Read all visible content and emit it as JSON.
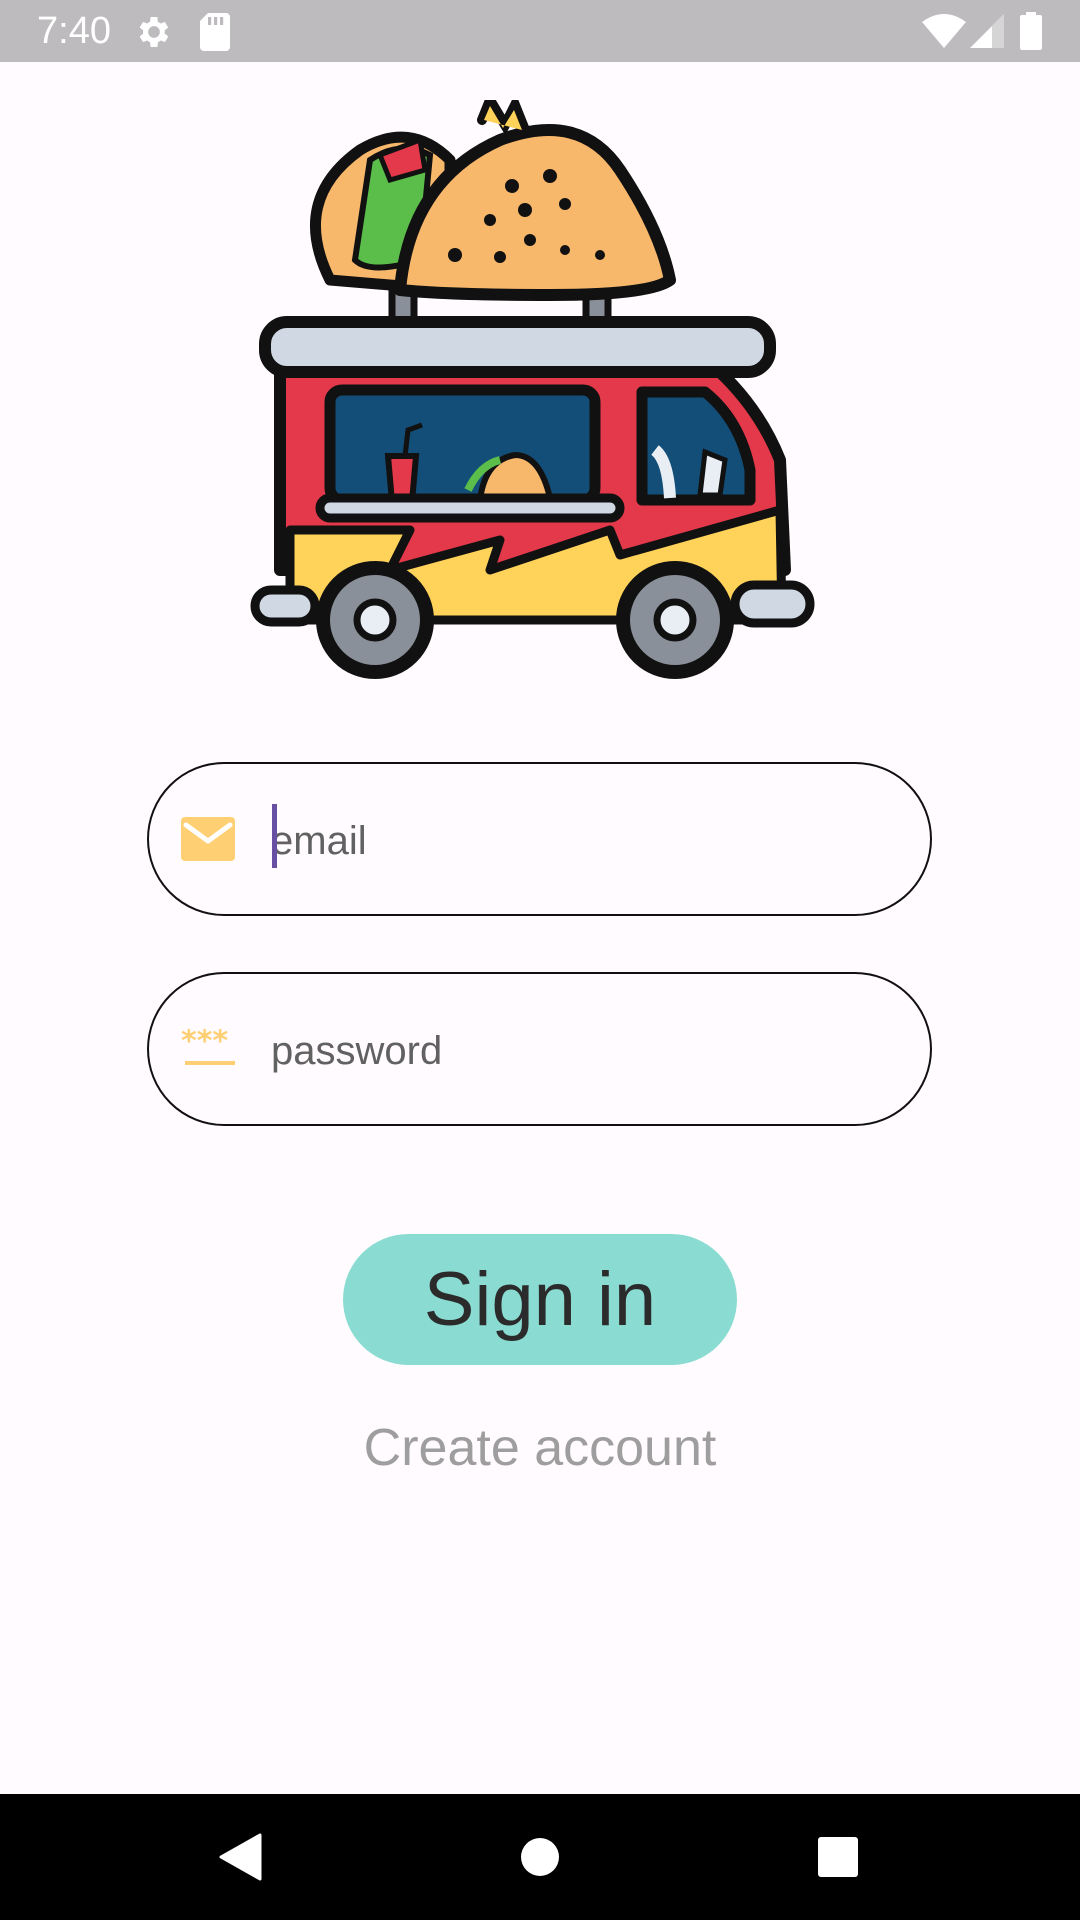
{
  "status_bar": {
    "time": "7:40",
    "icons": [
      "settings-icon",
      "sd-card-icon",
      "wifi-icon",
      "signal-icon",
      "battery-icon"
    ]
  },
  "logo": {
    "icon": "taco-food-truck-logo"
  },
  "email": {
    "icon": "envelope-icon",
    "value": "",
    "placeholder": "email"
  },
  "password": {
    "icon": "password-asterisks-icon",
    "value": "",
    "placeholder": "password"
  },
  "sign_in": {
    "label": "Sign in"
  },
  "create_account": {
    "label": "Create account"
  },
  "colors": {
    "accent": "#8adcd3",
    "icon_yellow": "#ffcf73",
    "caret": "#6750a4",
    "background": "#fffbfe"
  },
  "nav": {
    "icons": [
      "back-icon",
      "home-icon",
      "recents-icon"
    ]
  }
}
